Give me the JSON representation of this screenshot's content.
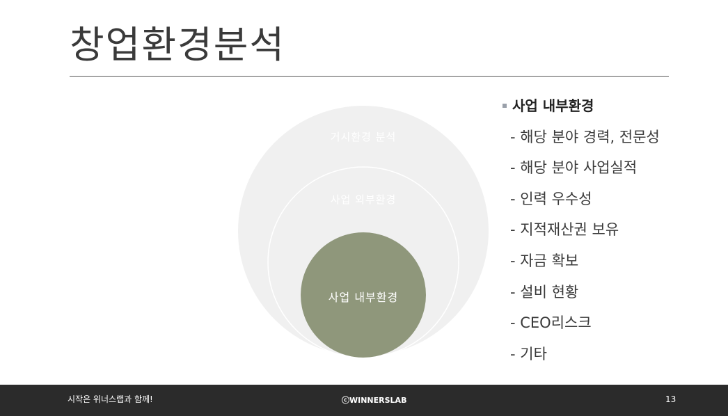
{
  "title": "창업환경분석",
  "diagram": {
    "outer_label": "거시환경 분석",
    "middle_label": "사업 외부환경",
    "inner_label": "사업 내부환경",
    "colors": {
      "outer": "#f0f0f0",
      "middle_stroke": "#ffffff",
      "inner": "#8f977b"
    }
  },
  "list": {
    "heading": "사업 내부환경",
    "items": [
      "- 해당 분야 경력, 전문성",
      "- 해당 분야 사업실적",
      "- 인력 우수성",
      "- 지적재산권 보유",
      "- 자금 확보",
      "- 설비 현황",
      "- CEO리스크",
      "- 기타"
    ]
  },
  "footer": {
    "slogan": "시작은 위너스랩과 함께!",
    "copyright": "ⓒWINNERSLAB",
    "page_number": "13"
  }
}
